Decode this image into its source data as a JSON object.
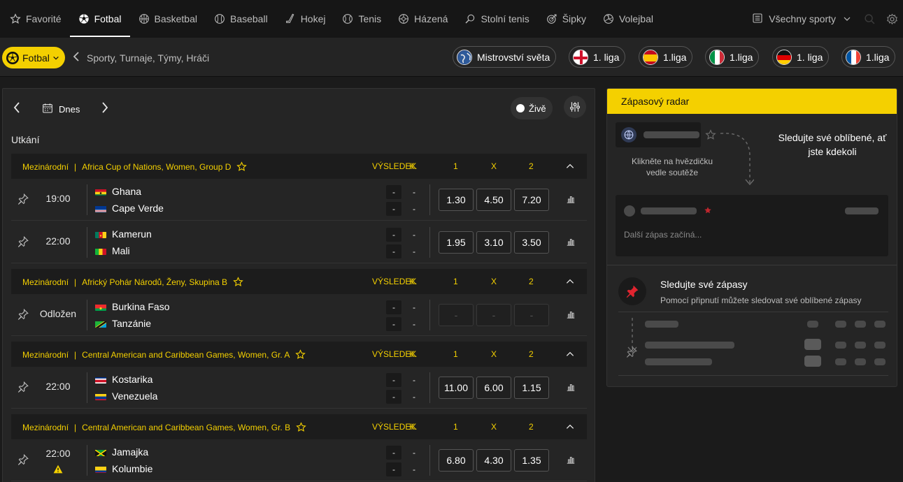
{
  "nav": {
    "items": [
      {
        "label": "Favorité",
        "icon": "star-icon"
      },
      {
        "label": "Fotbal",
        "icon": "soccer-ball-icon",
        "active": true
      },
      {
        "label": "Basketbal",
        "icon": "basketball-icon"
      },
      {
        "label": "Baseball",
        "icon": "baseball-icon"
      },
      {
        "label": "Hokej",
        "icon": "hockey-stick-icon"
      },
      {
        "label": "Tenis",
        "icon": "tennis-ball-icon"
      },
      {
        "label": "Házená",
        "icon": "handball-icon"
      },
      {
        "label": "Stolní tenis",
        "icon": "table-tennis-icon"
      },
      {
        "label": "Šipky",
        "icon": "darts-icon"
      },
      {
        "label": "Volejbal",
        "icon": "volleyball-icon"
      }
    ],
    "all_sports": "Všechny sporty"
  },
  "subbar": {
    "sport_pill": "Fotbal",
    "breadcrumb": "Sporty, Turnaje, Týmy, Hráči",
    "leagues": [
      {
        "label": "Mistrovství světa",
        "flag": "world"
      },
      {
        "label": "1. liga",
        "flag": "england"
      },
      {
        "label": "1.liga",
        "flag": "spain"
      },
      {
        "label": "1.liga",
        "flag": "italy"
      },
      {
        "label": "1. liga",
        "flag": "germany"
      },
      {
        "label": "1.liga",
        "flag": "france"
      }
    ]
  },
  "main": {
    "date_label": "Dnes",
    "live_label": "Živě",
    "section_title": "Utkání",
    "columns": {
      "result": "VÝSLEDEK",
      "period": "K.",
      "one": "1",
      "x": "X",
      "two": "2"
    },
    "groups": [
      {
        "country": "Mezinárodní",
        "competition": "Africa Cup of Nations, Women, Group D",
        "matches": [
          {
            "time": "19:00",
            "home": "Ghana",
            "away": "Cape Verde",
            "home_flag": "ghana",
            "away_flag": "cape-verde",
            "score_home": "-",
            "score_away": "-",
            "k_home": "-",
            "k_away": "-",
            "odds": [
              "1.30",
              "4.50",
              "7.20"
            ],
            "odds_disabled": false
          },
          {
            "time": "22:00",
            "home": "Kamerun",
            "away": "Mali",
            "home_flag": "cameroon",
            "away_flag": "mali",
            "score_home": "-",
            "score_away": "-",
            "k_home": "-",
            "k_away": "-",
            "odds": [
              "1.95",
              "3.10",
              "3.50"
            ],
            "odds_disabled": false
          }
        ]
      },
      {
        "country": "Mezinárodní",
        "competition": "Africký Pohár Národů, Ženy, Skupina B",
        "matches": [
          {
            "time": "Odložen",
            "home": "Burkina Faso",
            "away": "Tanzánie",
            "home_flag": "burkina-faso",
            "away_flag": "tanzania",
            "score_home": "-",
            "score_away": "-",
            "k_home": "-",
            "k_away": "-",
            "odds": [
              "-",
              "-",
              "-"
            ],
            "odds_disabled": true
          }
        ]
      },
      {
        "country": "Mezinárodní",
        "competition": "Central American and Caribbean Games, Women, Gr. A",
        "matches": [
          {
            "time": "22:00",
            "home": "Kostarika",
            "away": "Venezuela",
            "home_flag": "costa-rica",
            "away_flag": "venezuela",
            "score_home": "-",
            "score_away": "-",
            "k_home": "-",
            "k_away": "-",
            "odds": [
              "11.00",
              "6.00",
              "1.15"
            ],
            "odds_disabled": false
          }
        ]
      },
      {
        "country": "Mezinárodní",
        "competition": "Central American and Caribbean Games, Women, Gr. B",
        "matches": [
          {
            "time": "22:00",
            "home": "Jamajka",
            "away": "Kolumbie",
            "home_flag": "jamaica",
            "away_flag": "colombia",
            "score_home": "-",
            "score_away": "-",
            "k_home": "-",
            "k_away": "-",
            "odds": [
              "6.80",
              "4.30",
              "1.35"
            ],
            "odds_disabled": false,
            "warning": true
          }
        ]
      }
    ]
  },
  "radar": {
    "title": "Zápasový radar",
    "follow_text": "Sledujte své oblíbené, ať jste kdekoli",
    "hint": "Klikněte na hvězdičku vedle soutěže",
    "next_match": "Další zápas začíná...",
    "track_title": "Sledujte své zápasy",
    "track_desc": "Pomocí připnutí můžete sledovat své oblíbené zápasy"
  },
  "colors": {
    "accent": "#f4d000",
    "background": "#1b1b1b",
    "panel": "#252525"
  }
}
